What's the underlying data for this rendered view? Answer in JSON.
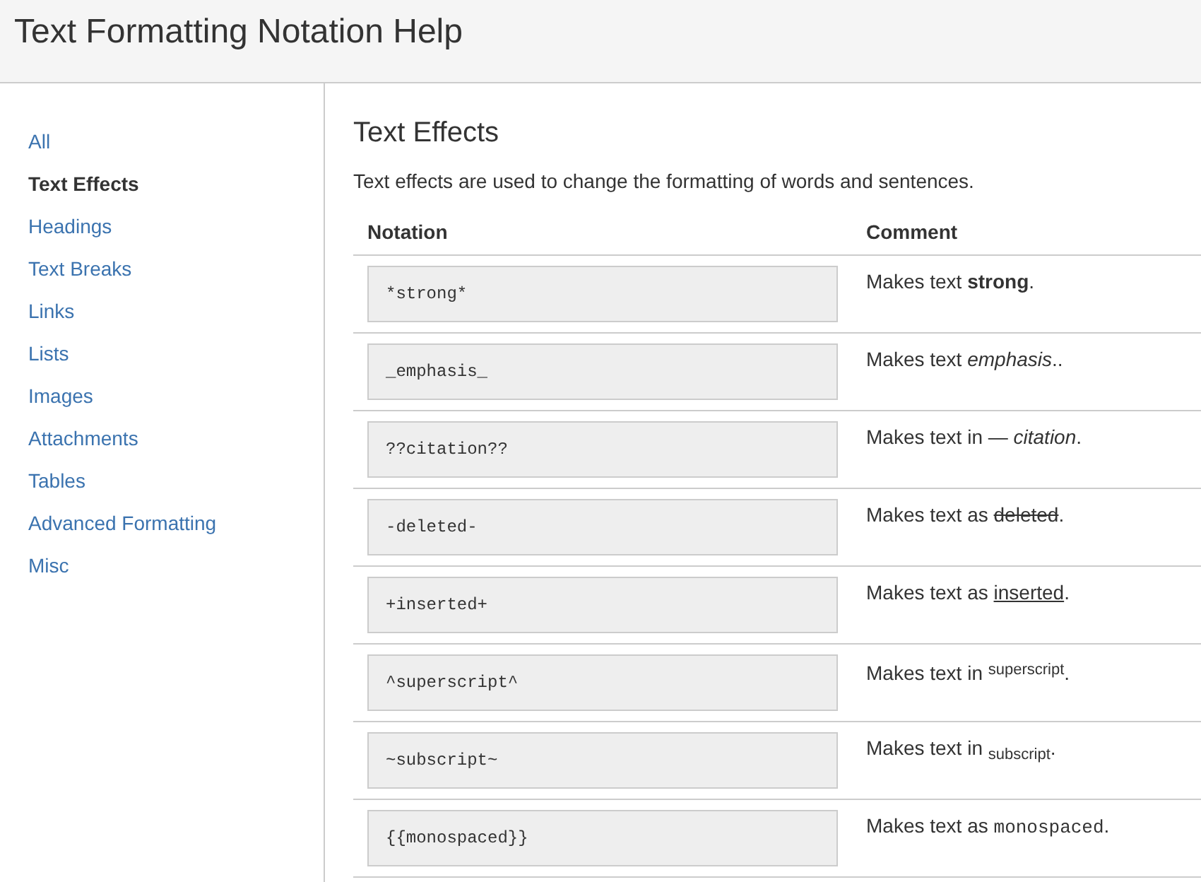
{
  "header": {
    "title": "Text Formatting Notation Help"
  },
  "sidebar": {
    "items": [
      {
        "label": "All",
        "selected": false
      },
      {
        "label": "Text Effects",
        "selected": true
      },
      {
        "label": "Headings",
        "selected": false
      },
      {
        "label": "Text Breaks",
        "selected": false
      },
      {
        "label": "Links",
        "selected": false
      },
      {
        "label": "Lists",
        "selected": false
      },
      {
        "label": "Images",
        "selected": false
      },
      {
        "label": "Attachments",
        "selected": false
      },
      {
        "label": "Tables",
        "selected": false
      },
      {
        "label": "Advanced Formatting",
        "selected": false
      },
      {
        "label": "Misc",
        "selected": false
      }
    ]
  },
  "section": {
    "title": "Text Effects",
    "description": "Text effects are used to change the formatting of words and sentences.",
    "table": {
      "columns": [
        "Notation",
        "Comment"
      ],
      "rows": [
        {
          "notation": "*strong*",
          "comment": [
            {
              "kind": "plain",
              "text": "Makes text "
            },
            {
              "kind": "strong",
              "text": "strong"
            },
            {
              "kind": "plain",
              "text": "."
            }
          ]
        },
        {
          "notation": "_emphasis_",
          "comment": [
            {
              "kind": "plain",
              "text": "Makes text "
            },
            {
              "kind": "emphasis",
              "text": "emphasis"
            },
            {
              "kind": "plain",
              "text": ".."
            }
          ]
        },
        {
          "notation": "??citation??",
          "comment": [
            {
              "kind": "plain",
              "text": "Makes text in — "
            },
            {
              "kind": "citation",
              "text": "citation"
            },
            {
              "kind": "plain",
              "text": "."
            }
          ]
        },
        {
          "notation": "-deleted-",
          "comment": [
            {
              "kind": "plain",
              "text": "Makes text as "
            },
            {
              "kind": "deleted",
              "text": "deleted"
            },
            {
              "kind": "plain",
              "text": "."
            }
          ]
        },
        {
          "notation": "+inserted+",
          "comment": [
            {
              "kind": "plain",
              "text": "Makes text as "
            },
            {
              "kind": "inserted",
              "text": "inserted"
            },
            {
              "kind": "plain",
              "text": "."
            }
          ]
        },
        {
          "notation": "^superscript^",
          "comment": [
            {
              "kind": "plain",
              "text": "Makes text in "
            },
            {
              "kind": "superscript",
              "text": "superscript"
            },
            {
              "kind": "plain",
              "text": "."
            }
          ]
        },
        {
          "notation": "~subscript~",
          "comment": [
            {
              "kind": "plain",
              "text": "Makes text in "
            },
            {
              "kind": "subscript",
              "text": "subscript"
            },
            {
              "kind": "plain",
              "text": "."
            }
          ]
        },
        {
          "notation": "{{monospaced}}",
          "comment": [
            {
              "kind": "plain",
              "text": "Makes text as "
            },
            {
              "kind": "monospaced",
              "text": "monospaced"
            },
            {
              "kind": "plain",
              "text": "."
            }
          ]
        }
      ]
    }
  }
}
